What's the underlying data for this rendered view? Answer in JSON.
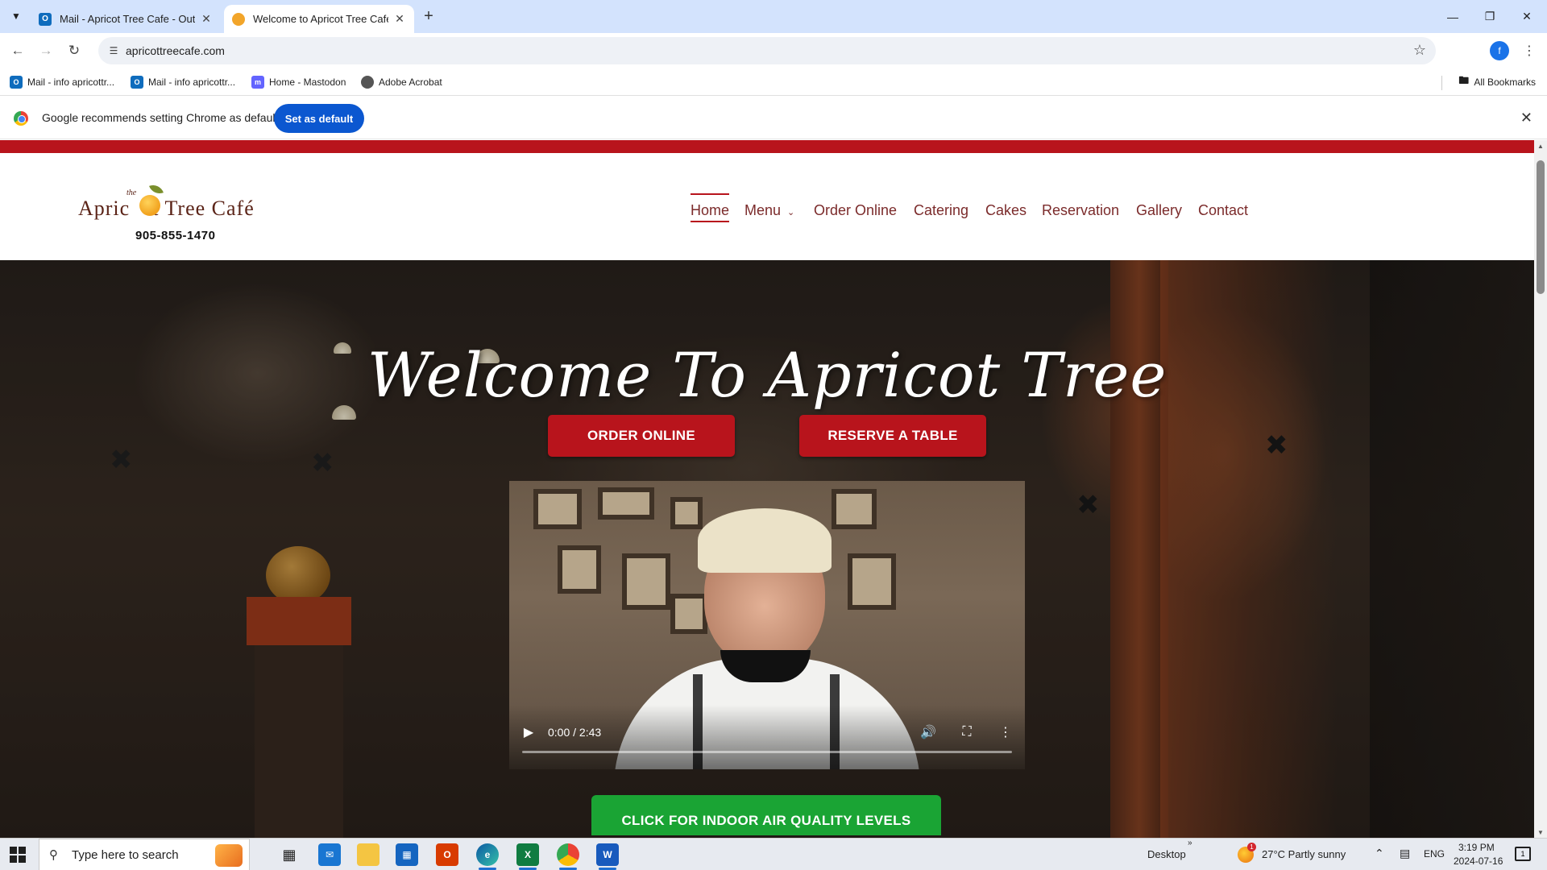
{
  "browser": {
    "tabs": [
      {
        "title": "Mail - Apricot Tree Cafe - Outlo",
        "favicon": "outlook-icon",
        "active": false
      },
      {
        "title": "Welcome to Apricot Tree Cafe |",
        "favicon": "apricot-favicon-icon",
        "active": true
      }
    ],
    "url": "apricottreecafe.com",
    "profile_initial": "f",
    "bookmarks": [
      {
        "label": "Mail - info apricottr...",
        "icon": "outlook-icon"
      },
      {
        "label": "Mail - info apricottr...",
        "icon": "outlook-icon"
      },
      {
        "label": "Home - Mastodon",
        "icon": "mastodon-icon"
      },
      {
        "label": "Adobe Acrobat",
        "icon": "acrobat-icon"
      }
    ],
    "all_bookmarks": "All Bookmarks",
    "infobar": {
      "message": "Google recommends setting Chrome as default",
      "button": "Set as default"
    }
  },
  "site": {
    "logo": {
      "the": "the",
      "name_part1": "Apric",
      "name_part2": "t Tree Café",
      "phone": "905-855-1470"
    },
    "nav": [
      {
        "label": "Home",
        "active": true
      },
      {
        "label": "Menu",
        "has_dropdown": true
      },
      {
        "label": "Order Online"
      },
      {
        "label": "Catering"
      },
      {
        "label": "Cakes"
      },
      {
        "label": "Reservation"
      },
      {
        "label": "Gallery"
      },
      {
        "label": "Contact"
      }
    ],
    "hero": {
      "title": "Welcome To Apricot Tree",
      "order_button": "ORDER ONLINE",
      "reserve_button": "RESERVE A TABLE",
      "green_button": "CLICK FOR INDOOR AIR QUALITY LEVELS"
    },
    "video": {
      "time": "0:00 / 2:43",
      "progress": 0
    }
  },
  "taskbar": {
    "search_placeholder": "Type here to search",
    "apps": [
      "task-view-icon",
      "mail-icon",
      "file-explorer-icon",
      "store-icon",
      "office-icon",
      "edge-icon",
      "excel-icon",
      "chrome-icon",
      "word-icon"
    ],
    "desktop_label": "Desktop",
    "weather_badge": "1",
    "weather": "27°C  Partly sunny",
    "language": "ENG",
    "time": "3:19 PM",
    "date": "2024-07-16",
    "notification_count": "1"
  },
  "colors": {
    "brand_red": "#b8141c",
    "nav_text": "#7b2b2b",
    "green_button": "#1aa434",
    "chrome_blue": "#0b57d0"
  }
}
